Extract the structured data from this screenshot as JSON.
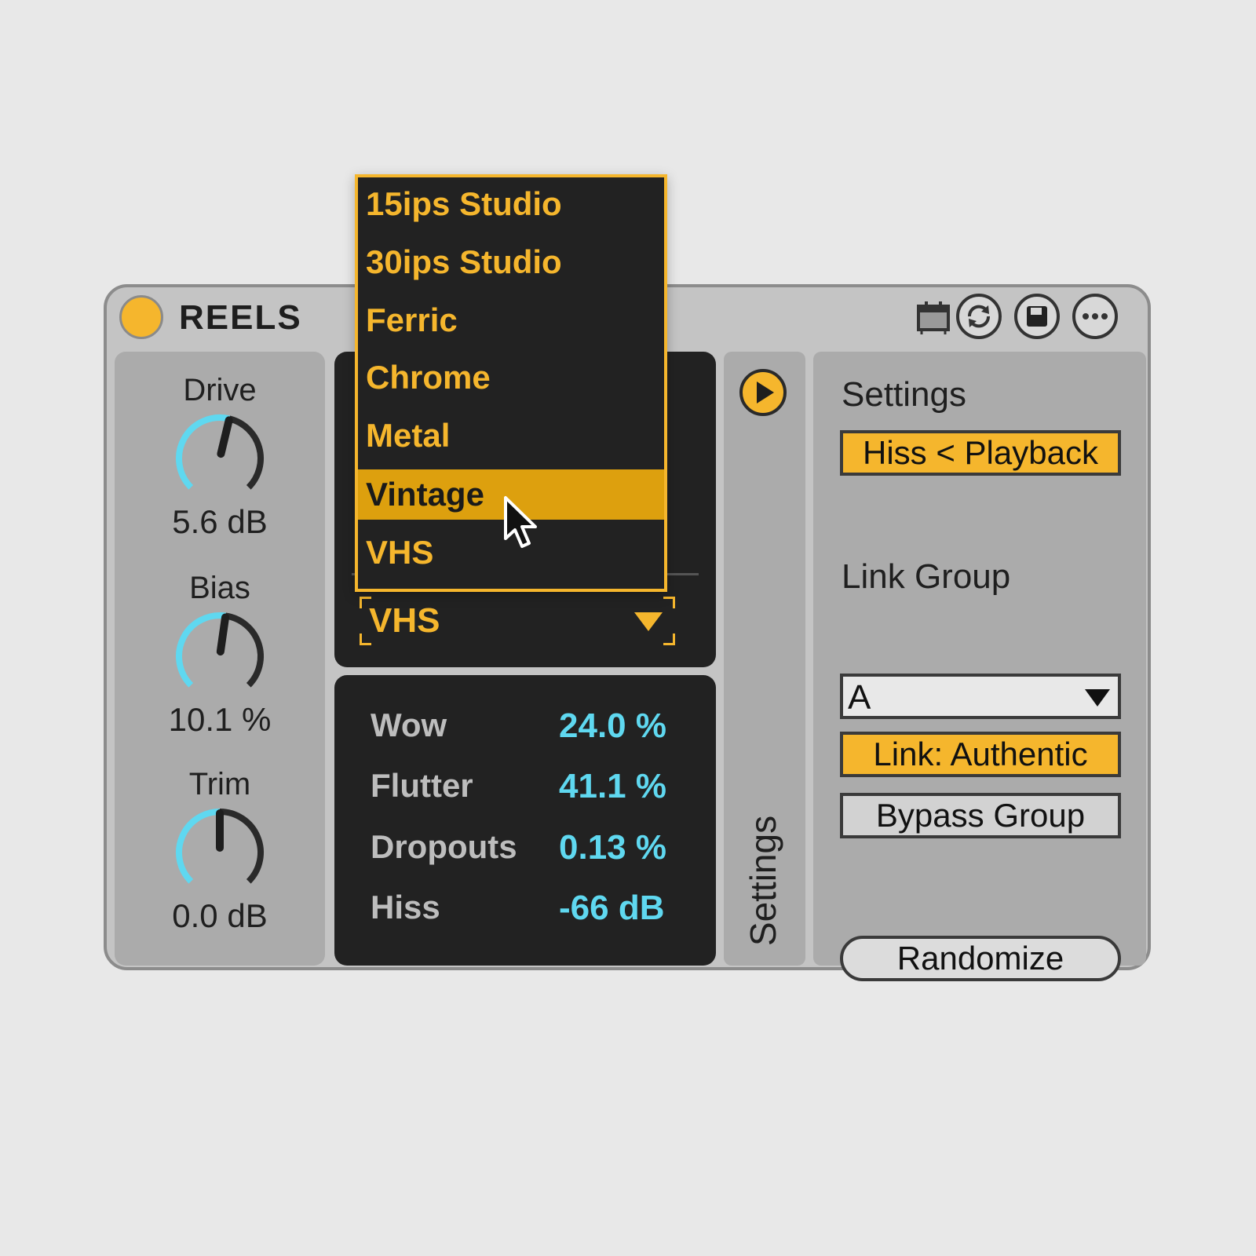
{
  "device": {
    "title": "REELS",
    "toolbar": [
      "calendar-icon",
      "sync-icon",
      "save-icon",
      "more-icon"
    ]
  },
  "knobs": [
    {
      "label": "Drive",
      "value": "5.6 dB",
      "level": 0.55
    },
    {
      "label": "Bias",
      "value": "10.1 %",
      "level": 0.53
    },
    {
      "label": "Trim",
      "value": "0.0 dB",
      "level": 0.5
    }
  ],
  "tape_menu": {
    "items": [
      "15ips Studio",
      "30ips Studio",
      "Ferric",
      "Chrome",
      "Metal",
      "Vintage",
      "VHS"
    ],
    "highlighted": "Vintage"
  },
  "tape_selector": {
    "value": "VHS"
  },
  "params": [
    {
      "label": "Wow",
      "value": "24.0 %"
    },
    {
      "label": "Flutter",
      "value": "41.1 %"
    },
    {
      "label": "Dropouts",
      "value": "0.13 %"
    },
    {
      "label": "Hiss",
      "value": "-66 dB"
    }
  ],
  "side_tab": {
    "label": "Settings"
  },
  "settings": {
    "heading": "Settings",
    "hiss_button": "Hiss < Playback",
    "link_group_label": "Link Group",
    "link_group_value": "A",
    "link_button": "Link: Authentic",
    "bypass_button": "Bypass Group",
    "randomize_button": "Randomize"
  },
  "colors": {
    "accent": "#f5b62d",
    "knob_arc": "#5fd8f0",
    "value_text": "#5fd8f0",
    "dark_panel": "#222222"
  }
}
